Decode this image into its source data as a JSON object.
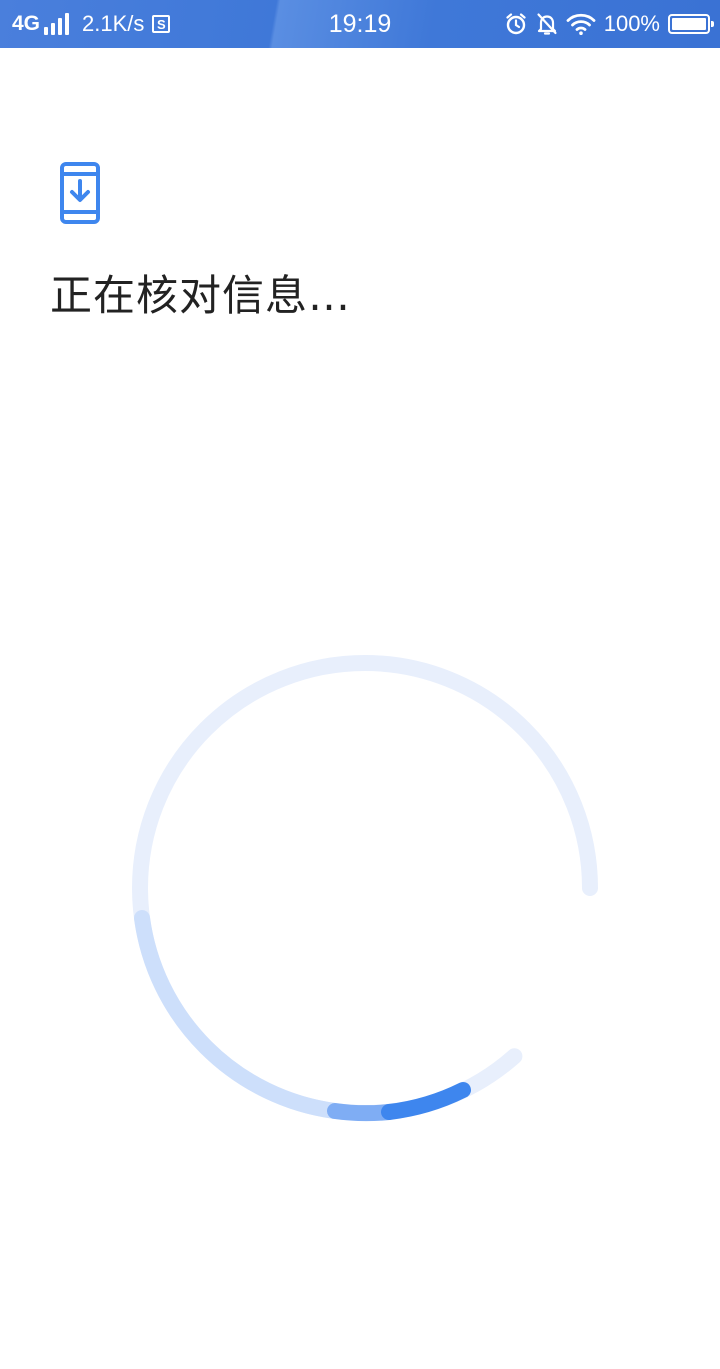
{
  "status_bar": {
    "network": "4G",
    "speed": "2.1K/s",
    "s_badge": "S",
    "time": "19:19",
    "battery_percent": "100%",
    "battery_level": 1.0,
    "icons": [
      "signal-icon",
      "s-badge-icon",
      "alarm-icon",
      "mute-icon",
      "wifi-icon",
      "battery-icon"
    ]
  },
  "main": {
    "icon": "phone-download-icon",
    "title": "正在核对信息…",
    "accent_color": "#3e86ee"
  },
  "progress": {
    "type": "indeterminate-spinner",
    "track_color": "#e8effc",
    "arc_colors": [
      "#cddffb",
      "#7fadf4",
      "#3e86ee"
    ]
  }
}
